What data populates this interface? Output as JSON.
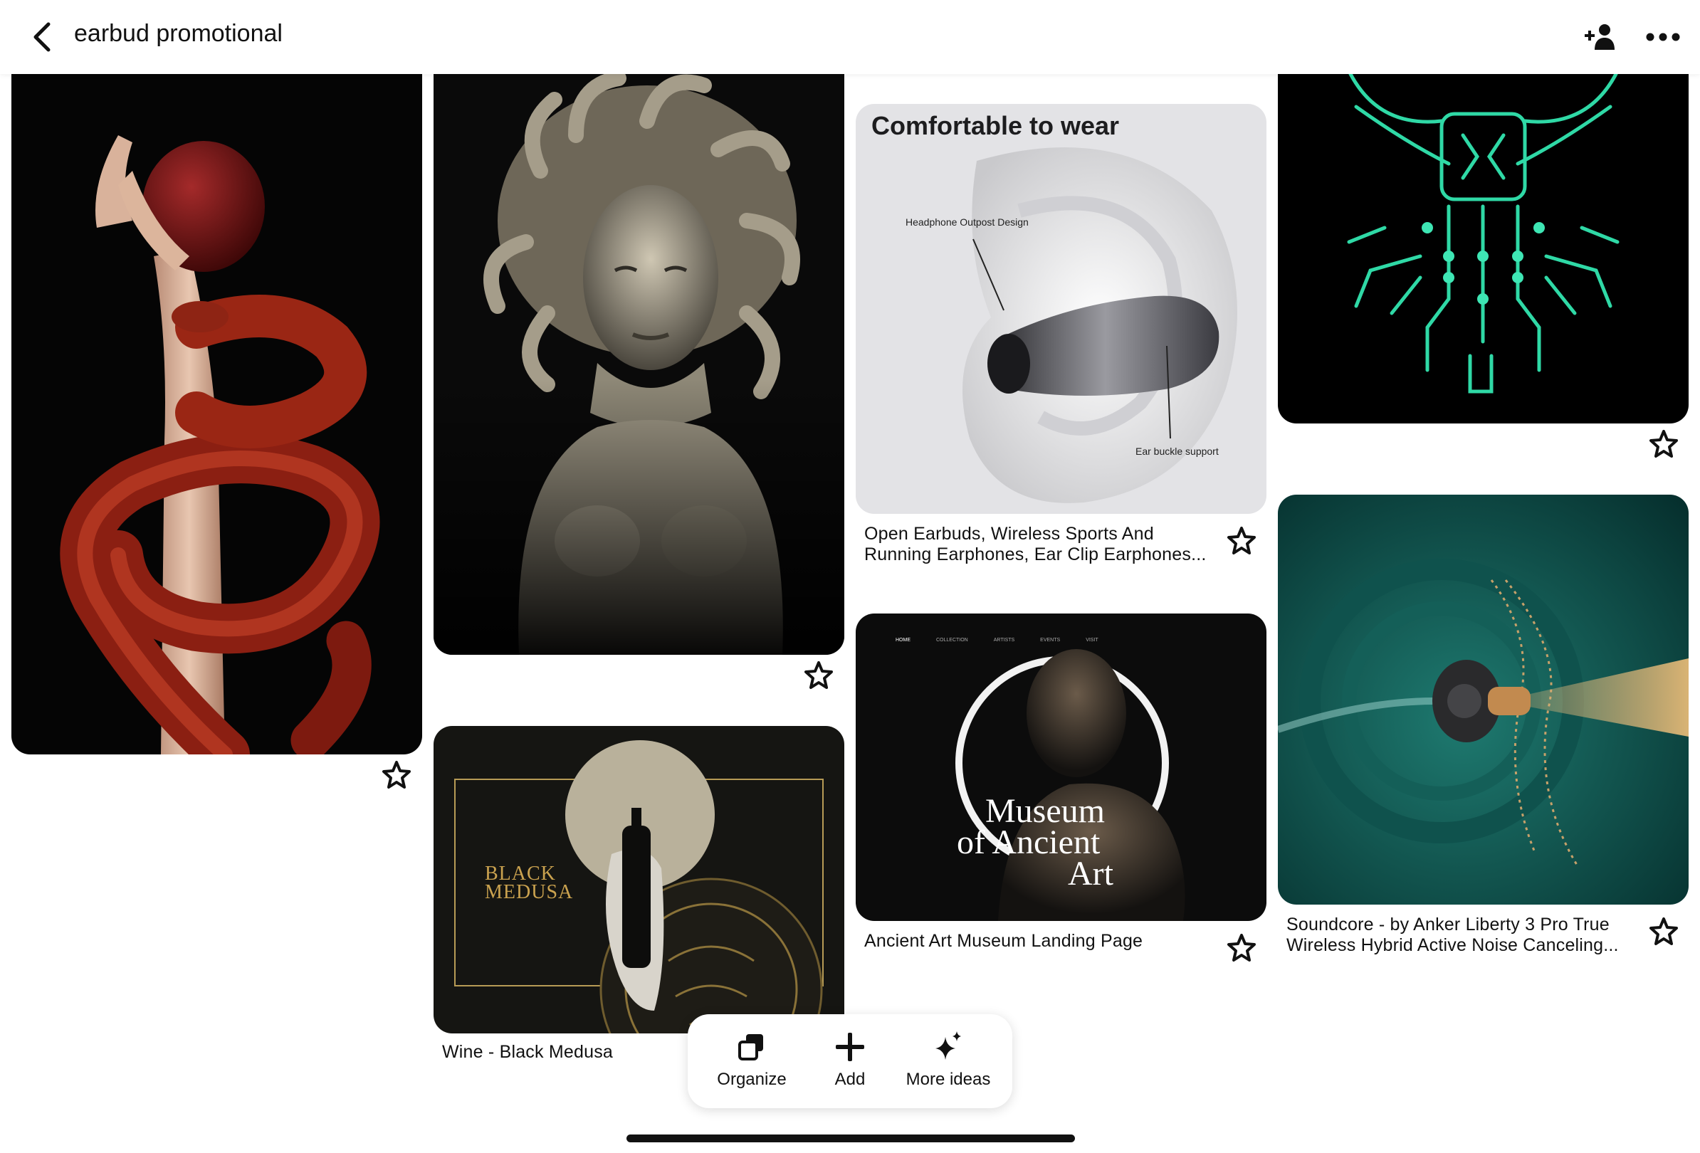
{
  "header": {
    "title": "earbud promotional"
  },
  "pins": [
    {
      "id": "snake",
      "title": ""
    },
    {
      "id": "medusa-statue",
      "title": ""
    },
    {
      "id": "earbuds-ear",
      "heading": "Comfortable to wear",
      "callout_top": "Headphone Outpost Design",
      "callout_bottom": "Ear buckle support",
      "title": "Open Earbuds, Wireless Sports And Running Earphones, Ear Clip Earphones..."
    },
    {
      "id": "circuit-totem",
      "title": ""
    },
    {
      "id": "wine",
      "art_line1": "BLACK",
      "art_line2": "MEDUSA",
      "title": "Wine - Black Medusa"
    },
    {
      "id": "museum",
      "nav": [
        "HOME",
        "COLLECTION",
        "ARTISTS",
        "EVENTS",
        "VISIT"
      ],
      "art_line1": "Museum",
      "art_line2": "of Ancient",
      "art_line3": "Art",
      "title": "Ancient Art Museum Landing Page"
    },
    {
      "id": "soundcore",
      "title": "Soundcore - by Anker Liberty 3 Pro True Wireless Hybrid Active Noise Canceling..."
    }
  ],
  "toolbar": {
    "organize": "Organize",
    "add": "Add",
    "more_ideas": "More ideas"
  },
  "colors": {
    "accent_glow": "#3ee6b4",
    "dark_bg": "#0b0b0b",
    "soundcore_bg": "#0e4a47"
  }
}
